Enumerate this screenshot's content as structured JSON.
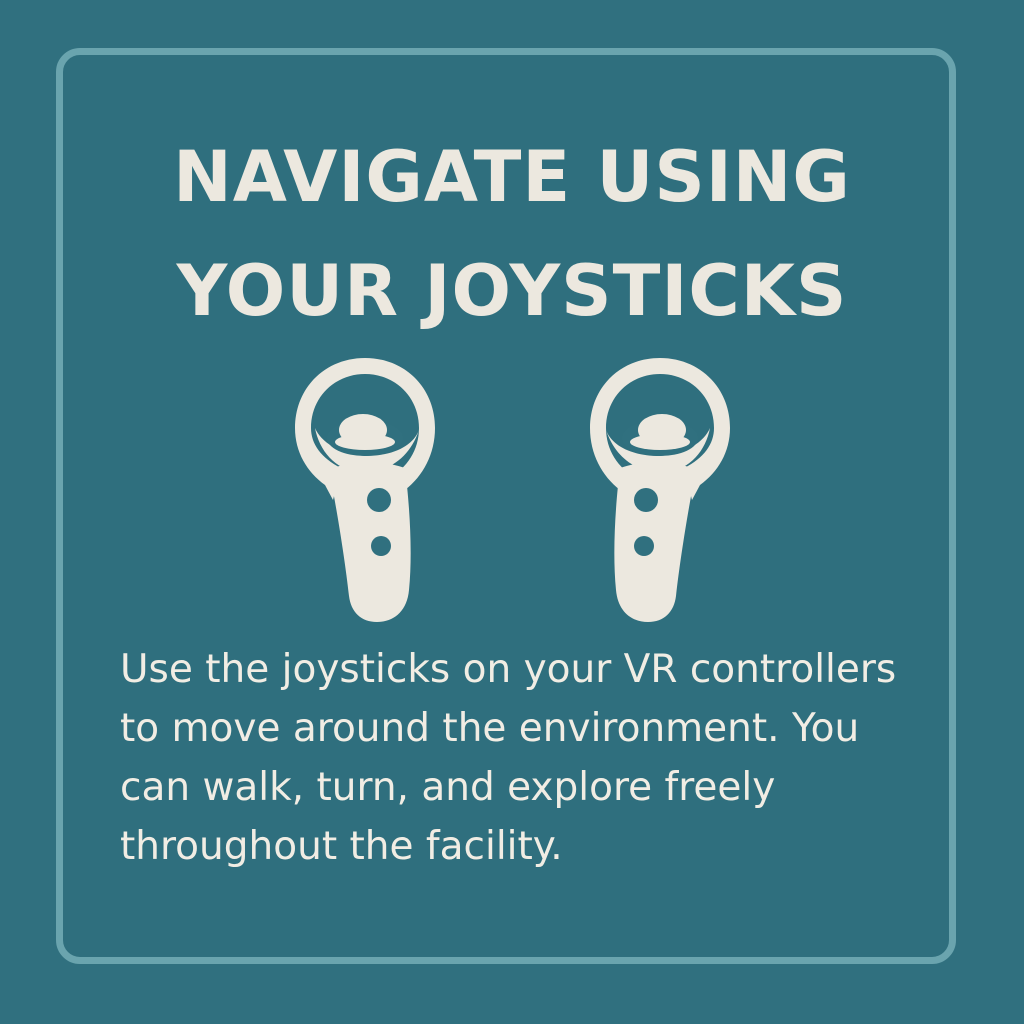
{
  "colors": {
    "background": "#30707f",
    "border": "#6aa4ae",
    "foreground": "#ece8df"
  },
  "title": {
    "line1": "NAVIGATE USING",
    "line2": "YOUR JOYSTICKS"
  },
  "icons": {
    "left": "vr-controller-icon",
    "right": "vr-controller-icon"
  },
  "description": "Use the joysticks on your VR controllers to move around the environment. You can walk, turn, and explore freely throughout the facility."
}
